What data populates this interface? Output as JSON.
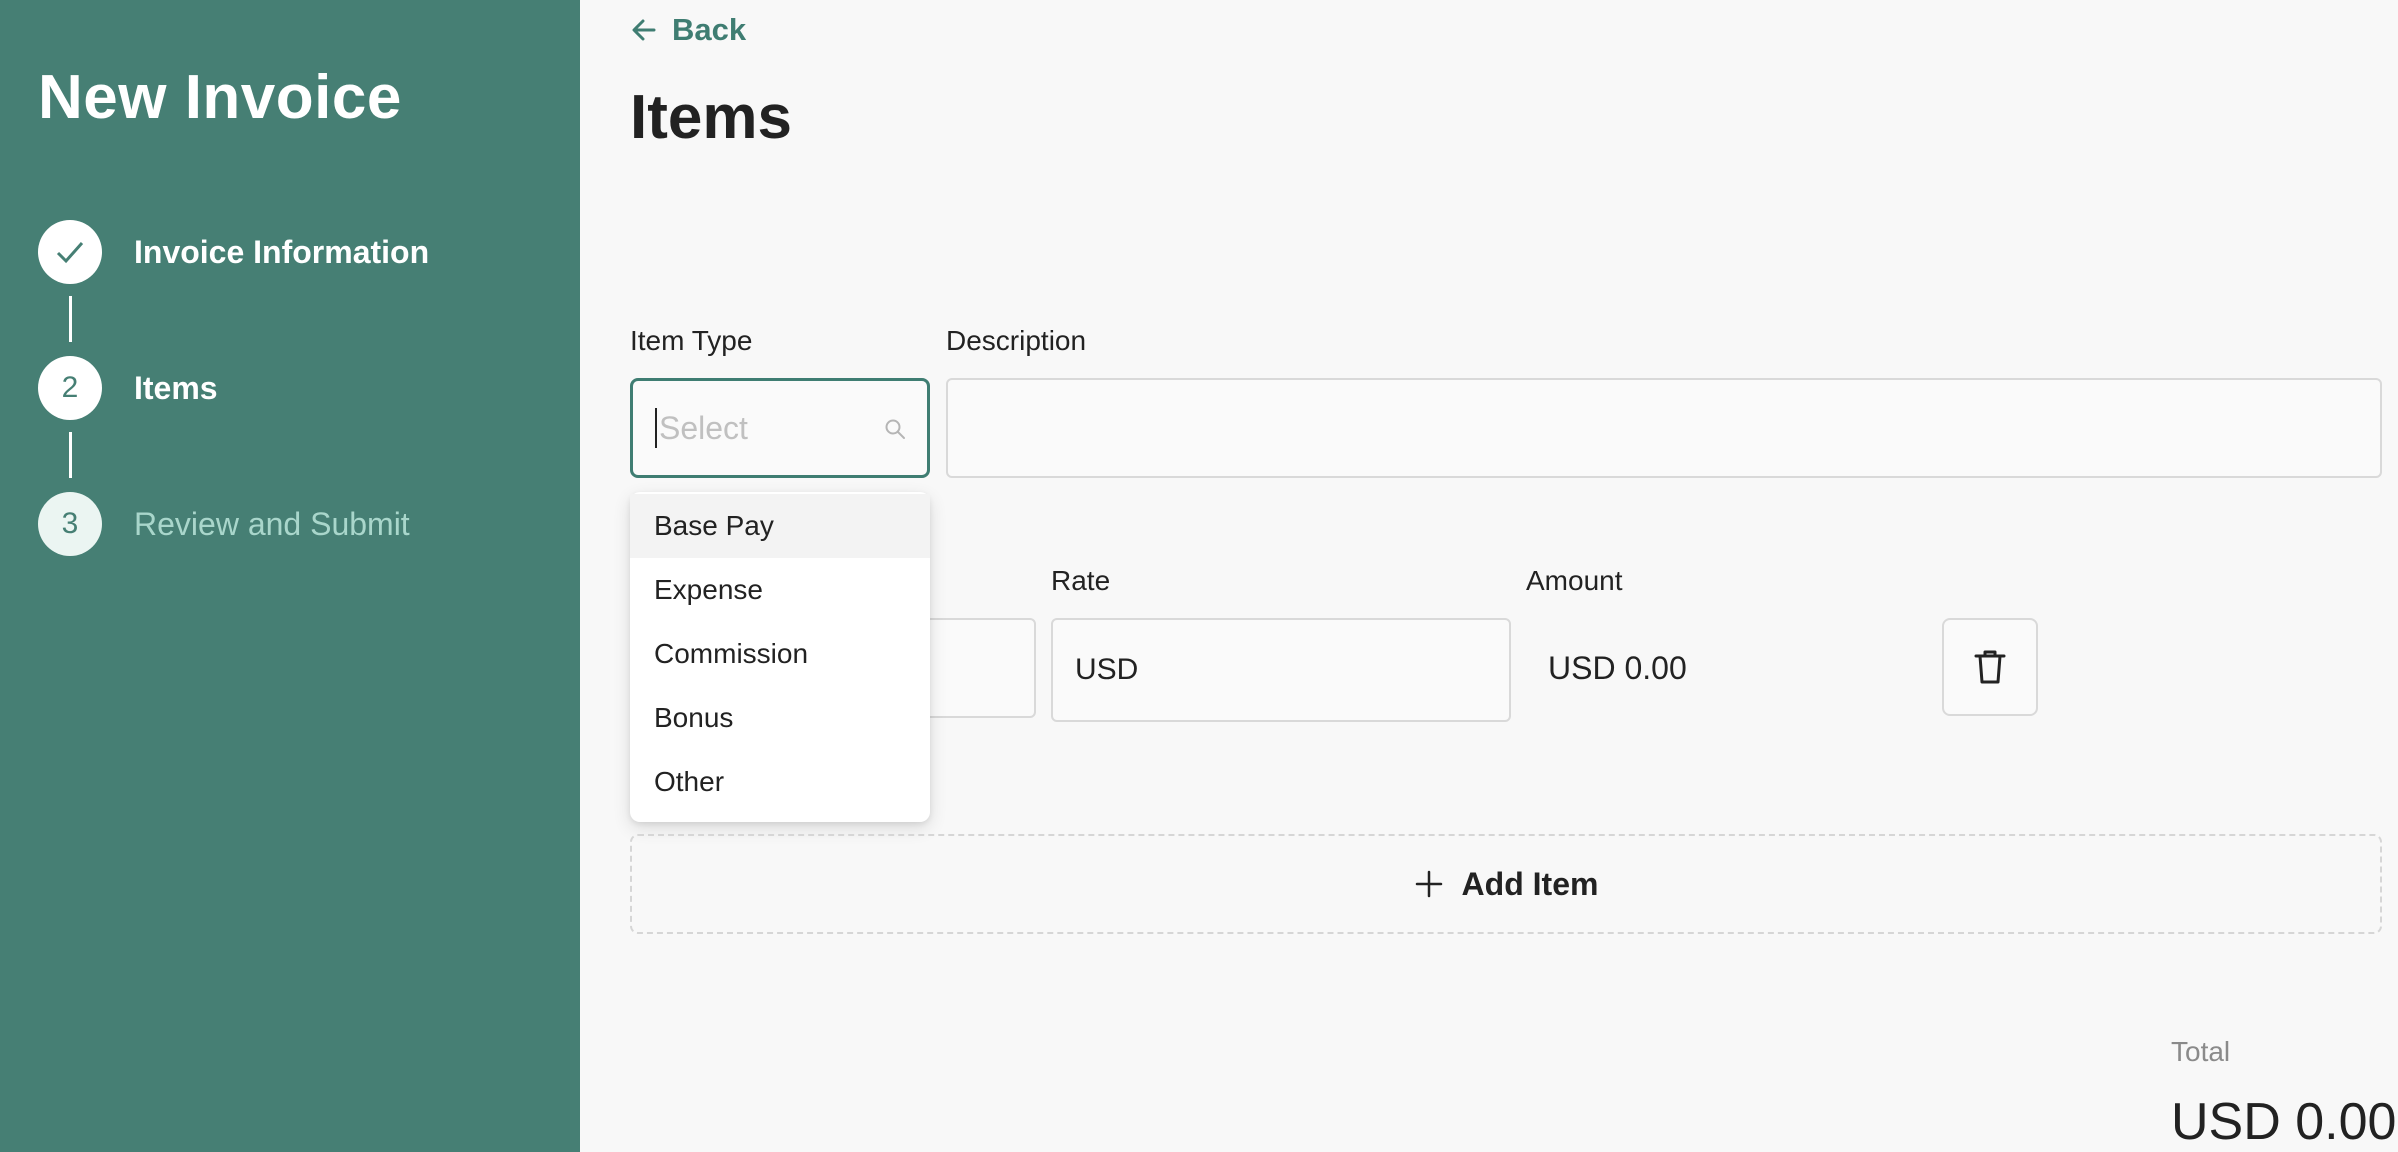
{
  "sidebar": {
    "title": "New Invoice",
    "steps": [
      {
        "number": "",
        "label": "Invoice Information",
        "status": "completed"
      },
      {
        "number": "2",
        "label": "Items",
        "status": "current"
      },
      {
        "number": "3",
        "label": "Review and Submit",
        "status": "pending"
      }
    ]
  },
  "header": {
    "back_label": "Back",
    "title": "Items"
  },
  "form": {
    "item_type_label": "Item Type",
    "item_type_placeholder": "Select",
    "description_label": "Description",
    "description_value": "",
    "rate_label": "Rate",
    "rate_value": "USD",
    "amount_label": "Amount",
    "amount_value": "USD 0.00"
  },
  "dropdown": {
    "options": [
      "Base Pay",
      "Expense",
      "Commission",
      "Bonus",
      "Other"
    ],
    "highlighted": "Base Pay"
  },
  "add_item_label": "Add Item",
  "totals": {
    "label": "Total",
    "value": "USD 0.00"
  },
  "colors": {
    "sidebar": "#467f74",
    "accent": "#3f7d72",
    "pending_text": "#a9d6cb"
  }
}
